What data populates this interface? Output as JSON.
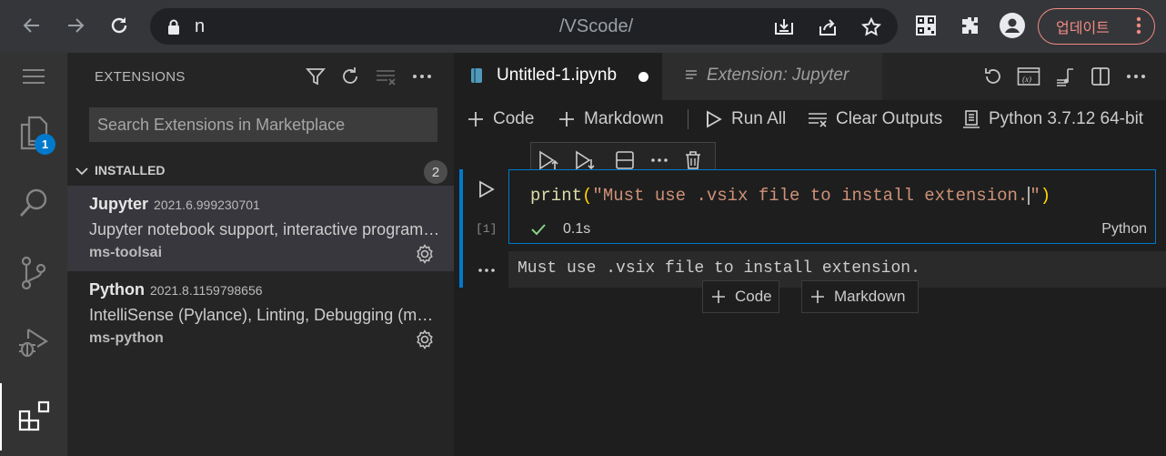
{
  "browser": {
    "url_left": "n",
    "url_mid": "/VScode/",
    "update_label": "업데이트"
  },
  "activity_bar": {
    "explorer_badge": "1"
  },
  "sidebar": {
    "title": "EXTENSIONS",
    "search_placeholder": "Search Extensions in Marketplace",
    "section": {
      "label": "INSTALLED",
      "count": "2"
    },
    "extensions": [
      {
        "name": "Jupyter",
        "version": "2021.6.999230701",
        "description": "Jupyter notebook support, interactive programming and computing that supports Intellisense, debugging and more.",
        "publisher": "ms-toolsai"
      },
      {
        "name": "Python",
        "version": "2021.8.1159798656",
        "description": "IntelliSense (Pylance), Linting, Debugging (multi-threaded, remote), Jupyter Notebooks, code formatting, refactoring...",
        "publisher": "ms-python"
      }
    ]
  },
  "editor": {
    "tabs": [
      {
        "label": "Untitled-1.ipynb"
      },
      {
        "label": "Extension: Jupyter"
      }
    ],
    "toolbar": {
      "code": "Code",
      "markdown": "Markdown",
      "run_all": "Run All",
      "clear_outputs": "Clear Outputs",
      "kernel": "Python 3.7.12 64-bit"
    },
    "cell": {
      "code_fn": "print",
      "code_open": "(",
      "code_string": "\"Must use .vsix file to install extension.",
      "code_string_end": "\"",
      "code_close": ")",
      "exec_count": "[1]",
      "duration": "0.1s",
      "language": "Python",
      "output": "Must use .vsix file to install extension."
    },
    "insert": {
      "code": "Code",
      "markdown": "Markdown"
    }
  },
  "colors": {
    "accent": "#007acc",
    "update_text": "#f28b82",
    "success_check": "#89d185",
    "string": "#ce9178",
    "function": "#dcdcaa",
    "bracket": "#ffd700"
  }
}
